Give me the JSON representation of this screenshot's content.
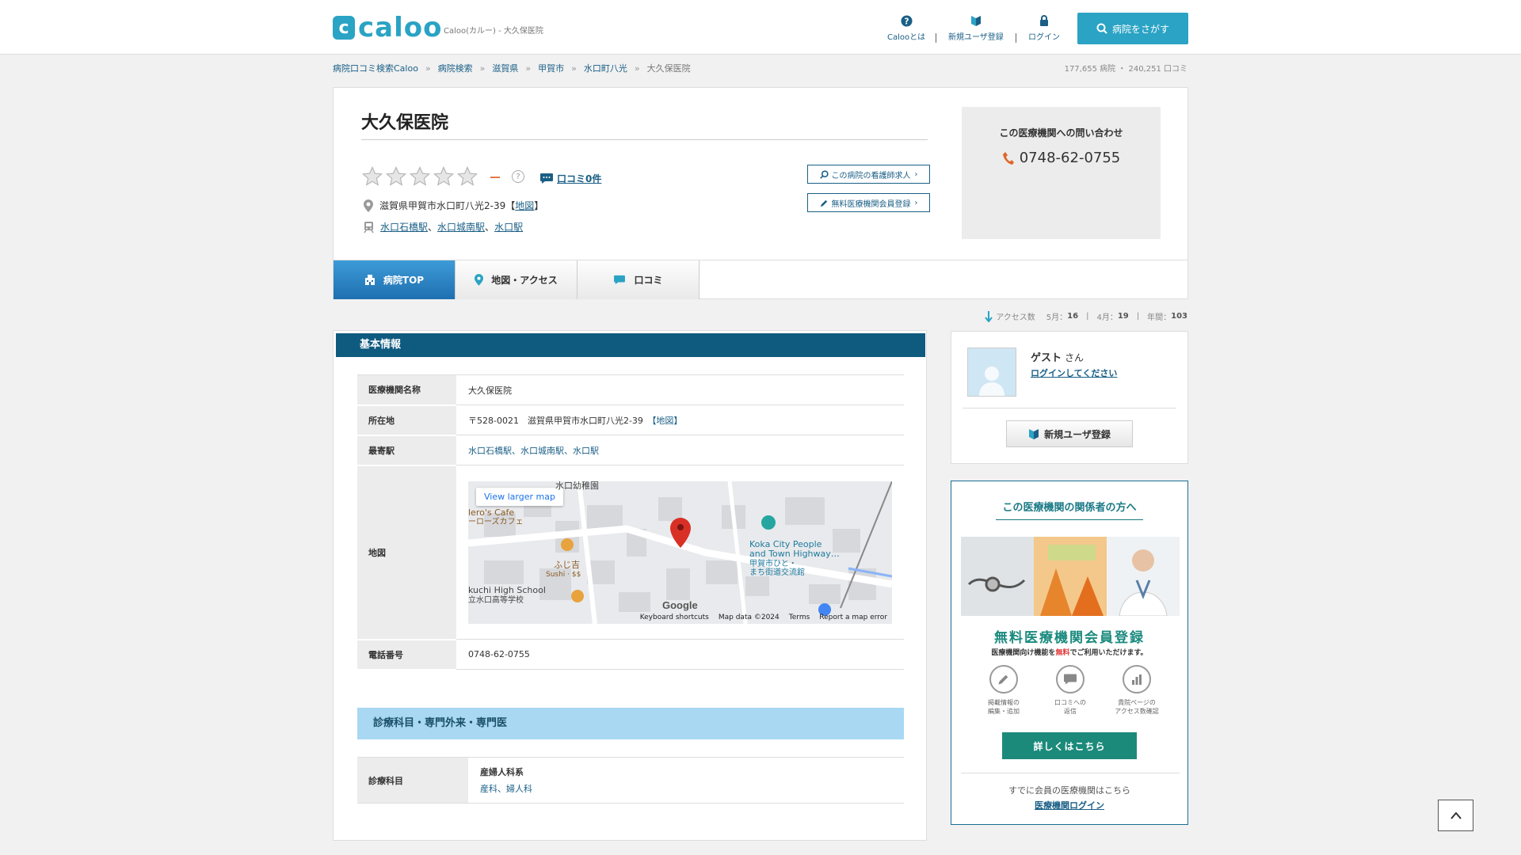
{
  "header": {
    "logo_mark": "c",
    "logo_text": "caloo",
    "logo_sub": "Caloo(カルー) - 大久保医院",
    "nav": [
      {
        "label": "Calooとは",
        "icon": "help-circle-icon"
      },
      {
        "label": "新規ユーザ登録",
        "icon": "beginner-leaf-icon"
      },
      {
        "label": "ログイン",
        "icon": "lock-icon"
      }
    ],
    "search_label": "病院をさがす"
  },
  "breadcrumb": {
    "items": [
      "病院口コミ検索Caloo",
      "病院検索",
      "滋賀県",
      "甲賀市",
      "水口町八光"
    ],
    "current": "大久保医院",
    "separator": "»"
  },
  "site_counts": "177,655 病院 ・ 240,251 口コミ",
  "hospital": {
    "name": "大久保医院",
    "rating_dash": "－",
    "help": "?",
    "review_link": "口コミ0件",
    "address": "滋賀県甲賀市水口町八光2-39",
    "map_link": "地図",
    "bracket_open": "【",
    "bracket_close": "】",
    "stations": [
      "水口石橋駅",
      "水口城南駅",
      "水口駅"
    ],
    "station_sep": "、",
    "nurse_btn": "この病院の看護師求人",
    "member_btn": "無料医療機関会員登録",
    "contact_title": "この医療機関への問い合わせ",
    "phone": "0748-62-0755"
  },
  "tabs": [
    {
      "label": "病院TOP",
      "icon": "hospital-icon",
      "active": true
    },
    {
      "label": "地図・アクセス",
      "icon": "pin-icon",
      "active": false
    },
    {
      "label": "口コミ",
      "icon": "speech-bubble-icon",
      "active": false
    }
  ],
  "access": {
    "label": "アクセス数",
    "may_label": "5月：",
    "may": "16",
    "apr_label": "4月：",
    "apr": "19",
    "year_label": "年間：",
    "year": "103"
  },
  "basic_info": {
    "title": "基本情報",
    "name_label": "医療機関名称",
    "name_value": "大久保医院",
    "address_label": "所在地",
    "address_value": "〒528-0021　滋賀県甲賀市水口町八光2-39",
    "address_map_link": "【地図】",
    "station_label": "最寄駅",
    "station_value": "水口石橋駅、水口城南駅、水口駅",
    "map_label": "地図",
    "phone_label": "電話番号",
    "phone_value": "0748-62-0755"
  },
  "map": {
    "view_larger": "View larger map",
    "labels": [
      "水口幼稚園",
      "lero's Cafe",
      "ーローズカフェ",
      "ふじ吉",
      "Sushi · $$",
      "kuchi High School",
      "立水口高等学校",
      "Koka City People",
      "and Town Highway…",
      "甲賀市ひと・",
      "まち街道交流館"
    ],
    "google": "Google",
    "footer": [
      "Keyboard shortcuts",
      "Map data ©2024",
      "Terms",
      "Report a map error"
    ]
  },
  "departments": {
    "title": "診療科目・専門外来・専門医",
    "label": "診療科目",
    "group": "産婦人科系",
    "items": "産科、婦人科"
  },
  "guest": {
    "name": "ゲスト",
    "suffix": "さん",
    "login": "ログインしてください",
    "register": "新規ユーザ登録"
  },
  "promo": {
    "title": "この医療機関の関係者の方へ",
    "big": "無料医療機関会員登録",
    "small_pre": "医療機関向け機能を",
    "small_red": "無料",
    "small_post": "でご利用いただけます。",
    "features": [
      {
        "line1": "掲載情報の",
        "line2": "編集・追加",
        "icon": "pencil-icon"
      },
      {
        "line1": "口コミへの",
        "line2": "返信",
        "icon": "chat-icon"
      },
      {
        "line1": "貴院ページの",
        "line2": "アクセス数確認",
        "icon": "chart-icon"
      }
    ],
    "button": "詳しくはこちら",
    "member_text": "すでに会員の医療機関はこちら",
    "member_login": "医療機関ログイン"
  },
  "colors": {
    "brand": "#2aa3c4",
    "section_header": "#0f5a7f",
    "tab_active": "#1f6fb0",
    "promo_green": "#1b8a7a",
    "rating_dash": "#e0662b"
  }
}
